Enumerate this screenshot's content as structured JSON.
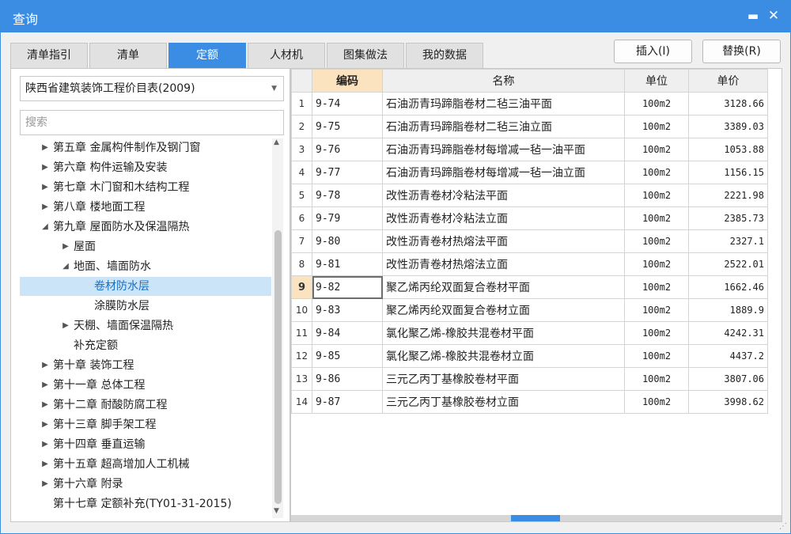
{
  "window": {
    "title": "查询",
    "minimize_glyph": "▬",
    "close_glyph": "✕"
  },
  "tabs": [
    {
      "label": "清单指引",
      "active": false
    },
    {
      "label": "清单",
      "active": false
    },
    {
      "label": "定额",
      "active": true
    },
    {
      "label": "人材机",
      "active": false
    },
    {
      "label": "图集做法",
      "active": false
    },
    {
      "label": "我的数据",
      "active": false
    }
  ],
  "actions": {
    "insert": "插入(I)",
    "replace": "替换(R)"
  },
  "library": {
    "selected": "陕西省建筑装饰工程价目表(2009)"
  },
  "search": {
    "placeholder": "搜索"
  },
  "tree": [
    {
      "label": "第五章 金属构件制作及钢门窗",
      "level": 0,
      "toggle": "▶",
      "selected": false
    },
    {
      "label": "第六章 构件运输及安装",
      "level": 0,
      "toggle": "▶",
      "selected": false
    },
    {
      "label": "第七章 木门窗和木结构工程",
      "level": 0,
      "toggle": "▶",
      "selected": false
    },
    {
      "label": "第八章 楼地面工程",
      "level": 0,
      "toggle": "▶",
      "selected": false
    },
    {
      "label": "第九章 屋面防水及保温隔热",
      "level": 0,
      "toggle": "◢",
      "selected": false
    },
    {
      "label": "屋面",
      "level": 1,
      "toggle": "▶",
      "selected": false
    },
    {
      "label": "地面、墙面防水",
      "level": 1,
      "toggle": "◢",
      "selected": false
    },
    {
      "label": "卷材防水层",
      "level": 2,
      "toggle": "",
      "selected": true
    },
    {
      "label": "涂膜防水层",
      "level": 2,
      "toggle": "",
      "selected": false
    },
    {
      "label": "天棚、墙面保温隔热",
      "level": 1,
      "toggle": "▶",
      "selected": false
    },
    {
      "label": "补充定额",
      "level": 1,
      "toggle": "",
      "selected": false
    },
    {
      "label": "第十章 装饰工程",
      "level": 0,
      "toggle": "▶",
      "selected": false
    },
    {
      "label": "第十一章 总体工程",
      "level": 0,
      "toggle": "▶",
      "selected": false
    },
    {
      "label": "第十二章 耐酸防腐工程",
      "level": 0,
      "toggle": "▶",
      "selected": false
    },
    {
      "label": "第十三章 脚手架工程",
      "level": 0,
      "toggle": "▶",
      "selected": false
    },
    {
      "label": "第十四章 垂直运输",
      "level": 0,
      "toggle": "▶",
      "selected": false
    },
    {
      "label": "第十五章 超高增加人工机械",
      "level": 0,
      "toggle": "▶",
      "selected": false
    },
    {
      "label": "第十六章 附录",
      "level": 0,
      "toggle": "▶",
      "selected": false
    },
    {
      "label": "第十七章 定额补充(TY01-31-2015)",
      "level": 0,
      "toggle": "",
      "selected": false
    }
  ],
  "table": {
    "columns": {
      "code": "编码",
      "name": "名称",
      "unit": "单位",
      "price": "单价"
    },
    "current_row": 9,
    "rows": [
      {
        "n": "1",
        "code": "9-74",
        "name": "石油沥青玛蹄脂卷材二毡三油平面",
        "unit": "100m2",
        "price": "3128.66"
      },
      {
        "n": "2",
        "code": "9-75",
        "name": "石油沥青玛蹄脂卷材二毡三油立面",
        "unit": "100m2",
        "price": "3389.03"
      },
      {
        "n": "3",
        "code": "9-76",
        "name": "石油沥青玛蹄脂卷材每增减一毡一油平面",
        "unit": "100m2",
        "price": "1053.88"
      },
      {
        "n": "4",
        "code": "9-77",
        "name": "石油沥青玛蹄脂卷材每增减一毡一油立面",
        "unit": "100m2",
        "price": "1156.15"
      },
      {
        "n": "5",
        "code": "9-78",
        "name": "改性沥青卷材冷粘法平面",
        "unit": "100m2",
        "price": "2221.98"
      },
      {
        "n": "6",
        "code": "9-79",
        "name": "改性沥青卷材冷粘法立面",
        "unit": "100m2",
        "price": "2385.73"
      },
      {
        "n": "7",
        "code": "9-80",
        "name": "改性沥青卷材热熔法平面",
        "unit": "100m2",
        "price": "2327.1"
      },
      {
        "n": "8",
        "code": "9-81",
        "name": "改性沥青卷材热熔法立面",
        "unit": "100m2",
        "price": "2522.01"
      },
      {
        "n": "9",
        "code": "9-82",
        "name": "聚乙烯丙纶双面复合卷材平面",
        "unit": "100m2",
        "price": "1662.46"
      },
      {
        "n": "10",
        "code": "9-83",
        "name": "聚乙烯丙纶双面复合卷材立面",
        "unit": "100m2",
        "price": "1889.9"
      },
      {
        "n": "11",
        "code": "9-84",
        "name": "氯化聚乙烯-橡胶共混卷材平面",
        "unit": "100m2",
        "price": "4242.31"
      },
      {
        "n": "12",
        "code": "9-85",
        "name": "氯化聚乙烯-橡胶共混卷材立面",
        "unit": "100m2",
        "price": "4437.2"
      },
      {
        "n": "13",
        "code": "9-86",
        "name": "三元乙丙丁基橡胶卷材平面",
        "unit": "100m2",
        "price": "3807.06"
      },
      {
        "n": "14",
        "code": "9-87",
        "name": "三元乙丙丁基橡胶卷材立面",
        "unit": "100m2",
        "price": "3998.62"
      }
    ]
  },
  "colors": {
    "accent": "#3b8de3",
    "header_highlight": "#fbe3c0",
    "tree_selected": "#cce4f7"
  }
}
